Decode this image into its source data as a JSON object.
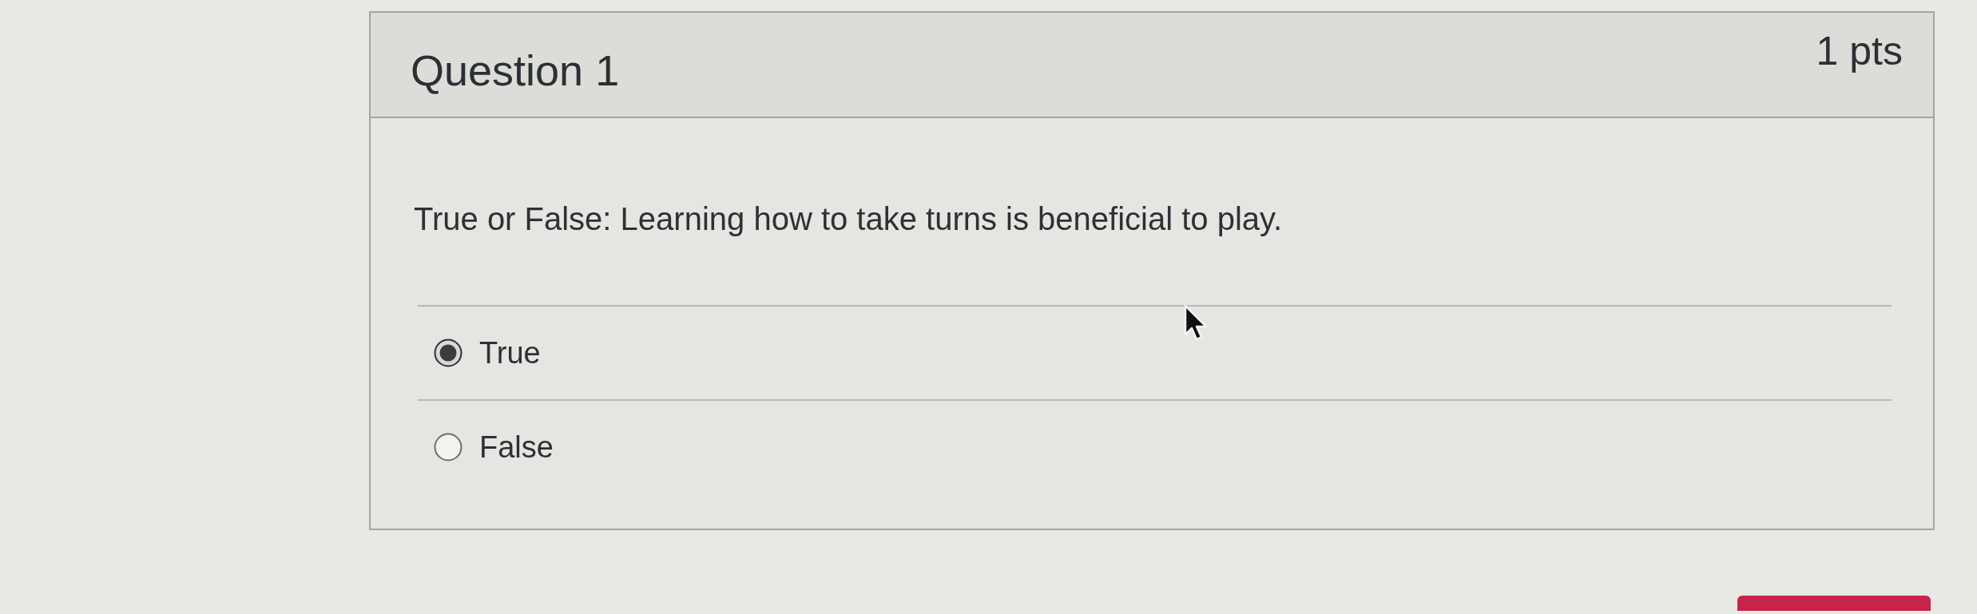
{
  "question": {
    "title": "Question 1",
    "points": "1 pts",
    "text": "True or False: Learning how to take turns is beneficial to play.",
    "answers": [
      {
        "label": "True",
        "selected": true
      },
      {
        "label": "False",
        "selected": false
      }
    ]
  }
}
